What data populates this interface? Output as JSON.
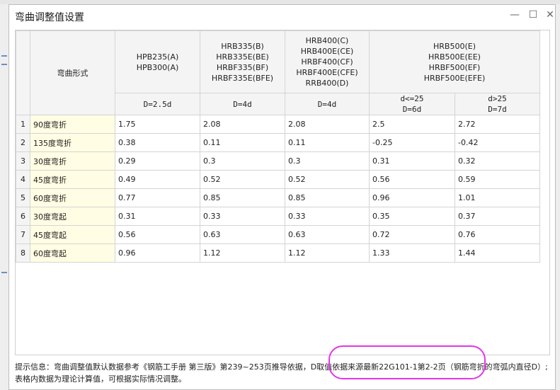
{
  "dialog": {
    "title": "弯曲调整值设置",
    "minimize_glyph": "—",
    "maximize_glyph": "☐",
    "close_glyph": "✕"
  },
  "table": {
    "form_header": "弯曲形式",
    "groups": [
      {
        "label": "HPB235(A)\nHPB300(A)"
      },
      {
        "label": "HRB335(B)\nHRB335E(BE)\nHRBF335(BF)\nHRBF335E(BFE)"
      },
      {
        "label": "HRB400(C)\nHRB400E(CE)\nHRBF400(CF)\nHRBF400E(CFE)\nRRB400(D)"
      },
      {
        "label": "HRB500(E)\nHRB500E(EE)\nHRBF500(EF)\nHRBF500E(EFE)"
      }
    ],
    "sub_headers": [
      "D=2.5d",
      "D=4d",
      "D=4d",
      "d<=25\nD=6d",
      "d>25\nD=7d"
    ],
    "rows": [
      {
        "num": "1",
        "name": "90度弯折",
        "values": [
          "1.75",
          "2.08",
          "2.08",
          "2.5",
          "2.72"
        ]
      },
      {
        "num": "2",
        "name": "135度弯折",
        "values": [
          "0.38",
          "0.11",
          "0.11",
          "-0.25",
          "-0.42"
        ]
      },
      {
        "num": "3",
        "name": "30度弯折",
        "values": [
          "0.29",
          "0.3",
          "0.3",
          "0.31",
          "0.32"
        ]
      },
      {
        "num": "4",
        "name": "45度弯折",
        "values": [
          "0.49",
          "0.52",
          "0.52",
          "0.56",
          "0.59"
        ]
      },
      {
        "num": "5",
        "name": "60度弯折",
        "values": [
          "0.77",
          "0.85",
          "0.85",
          "0.96",
          "1.01"
        ]
      },
      {
        "num": "6",
        "name": "30度弯起",
        "values": [
          "0.31",
          "0.33",
          "0.33",
          "0.35",
          "0.37"
        ]
      },
      {
        "num": "7",
        "name": "45度弯起",
        "values": [
          "0.56",
          "0.63",
          "0.63",
          "0.72",
          "0.76"
        ]
      },
      {
        "num": "8",
        "name": "60度弯起",
        "values": [
          "0.96",
          "1.12",
          "1.12",
          "1.33",
          "1.44"
        ]
      }
    ]
  },
  "info": {
    "part1": "提示信息：弯曲调整值默认数据参考《钢筋工手册 第三版》第239~253页推导依据，",
    "part2": "D取值依据来源最新22G101-1第2-2页",
    "part3": "（钢筋弯折的弯弧内直径D）;表格内数据为理论计算值，可根据实际情况调整。"
  },
  "colors": {
    "highlight": "#e535e6",
    "name_cell_bg": "#fffde3",
    "header_bg": "#f4f4f4"
  }
}
